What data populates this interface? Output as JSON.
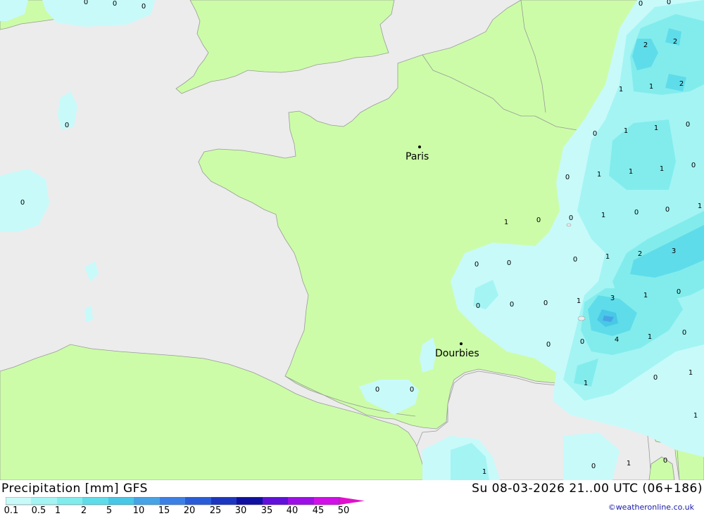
{
  "map": {
    "cities": [
      {
        "name": "Paris"
      },
      {
        "name": "Dourbies"
      }
    ],
    "value_labels": [
      "0",
      "0",
      "0",
      "0",
      "0",
      "2",
      "2",
      "1",
      "1",
      "2",
      "0",
      "1",
      "1",
      "0",
      "0",
      "1",
      "1",
      "1",
      "0",
      "0",
      "0",
      "1",
      "0",
      "0",
      "1",
      "0",
      "0",
      "1",
      "2",
      "3",
      "0",
      "0",
      "3",
      "1",
      "0",
      "1",
      "0",
      "0",
      "0",
      "1",
      "0",
      "4",
      "1",
      "0",
      "0",
      "0",
      "1",
      "0",
      "1",
      "0",
      "1",
      "0",
      "0",
      "1",
      "0",
      "1"
    ],
    "colors": {
      "sea": "#ececec",
      "land": "#ccfca8",
      "border": "#999999"
    }
  },
  "footer": {
    "title": "Precipitation [mm] GFS",
    "datetime": "Su 08-03-2026 21..00 UTC (06+186)",
    "credit": "©weatheronline.co.uk"
  },
  "legend": {
    "ticks": [
      "0.1",
      "0.5",
      "1",
      "2",
      "5",
      "10",
      "15",
      "20",
      "25",
      "30",
      "35",
      "40",
      "45",
      "50"
    ],
    "colors": [
      "#c8fafa",
      "#a4f4f4",
      "#82ecec",
      "#5fdcea",
      "#48c8e6",
      "#46a4e6",
      "#3c80e6",
      "#2a5cd8",
      "#1c36c0",
      "#1010a0",
      "#6010d8",
      "#9c10e6",
      "#d010e6",
      "#e010cc",
      "#b410b4"
    ]
  }
}
